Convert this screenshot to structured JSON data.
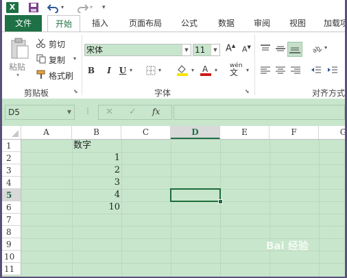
{
  "ribbon_tabs": [
    "文件",
    "开始",
    "插入",
    "页面布局",
    "公式",
    "数据",
    "审阅",
    "视图",
    "加载项"
  ],
  "clipboard": {
    "paste": "粘贴",
    "cut": "剪切",
    "copy": "复制",
    "format_painter": "格式刷",
    "group_label": "剪贴板"
  },
  "font": {
    "name": "宋体",
    "size": "11",
    "group_label": "字体",
    "bold": "B",
    "italic": "I",
    "underline": "U",
    "phonetic": "wén"
  },
  "alignment": {
    "group_label": "对齐方式"
  },
  "formula_bar": {
    "name_box": "D5",
    "fx": "fx",
    "value": ""
  },
  "columns": [
    "A",
    "B",
    "C",
    "D",
    "E",
    "F",
    "G"
  ],
  "selected_column": "D",
  "rows": [
    "1",
    "2",
    "3",
    "4",
    "5",
    "6",
    "7",
    "8",
    "9",
    "10",
    "11"
  ],
  "selected_row": "5",
  "cells": {
    "B1": "数字",
    "B2": "1",
    "B3": "2",
    "B4": "3",
    "B5": "4",
    "B6": "10"
  },
  "watermark": "Bai 经验",
  "colors": {
    "excel_green": "#1e7145",
    "eye_care_green": "#c7e6cc"
  }
}
